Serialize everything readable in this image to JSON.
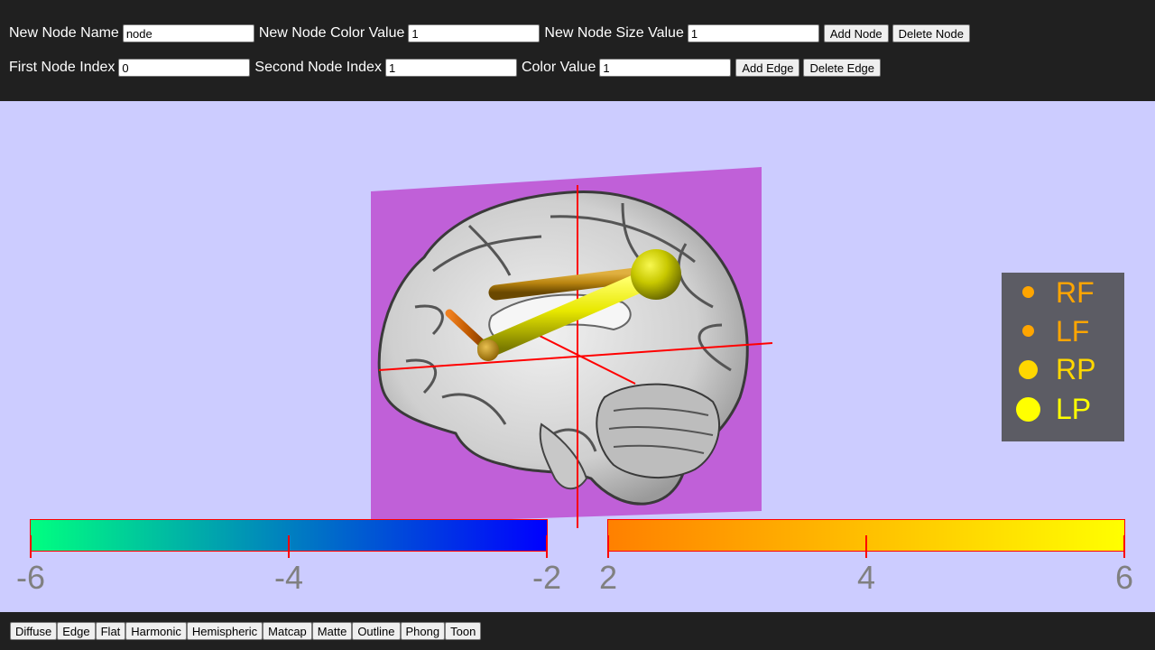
{
  "node_controls": {
    "name_label": "New Node Name",
    "name_value": "node",
    "color_label": "New Node Color Value",
    "color_value": "1",
    "size_label": "New Node Size Value",
    "size_value": "1",
    "add_label": "Add Node",
    "delete_label": "Delete Node"
  },
  "edge_controls": {
    "first_label": "First Node Index",
    "first_value": "0",
    "second_label": "Second Node Index",
    "second_value": "1",
    "color_label": "Color Value",
    "color_value": "1",
    "add_label": "Add Edge",
    "delete_label": "Delete Edge"
  },
  "legend": {
    "items": [
      {
        "label": "RF",
        "color": "#ffa500"
      },
      {
        "label": "LF",
        "color": "#ffa500"
      },
      {
        "label": "RP",
        "color": "#ffd700"
      },
      {
        "label": "LP",
        "color": "#ffff00"
      }
    ]
  },
  "colorbars": {
    "negative": {
      "min": -6,
      "max": -2,
      "from_color": "#00ff80",
      "to_color": "#0000ff",
      "ticks": [
        "-6",
        "-4",
        "-2"
      ]
    },
    "positive": {
      "min": 2,
      "max": 6,
      "from_color": "#ff8000",
      "to_color": "#ffff00",
      "ticks": [
        "2",
        "4",
        "6"
      ]
    }
  },
  "shaders": [
    "Diffuse",
    "Edge",
    "Flat",
    "Harmonic",
    "Hemispheric",
    "Matcap",
    "Matte",
    "Outline",
    "Phong",
    "Toon"
  ],
  "colors": {
    "background": "#ccccff",
    "toolbar": "#202020",
    "slice_plane": "#c060d8",
    "axis": "#ff0000",
    "legend_bg": "#5c5c64"
  }
}
